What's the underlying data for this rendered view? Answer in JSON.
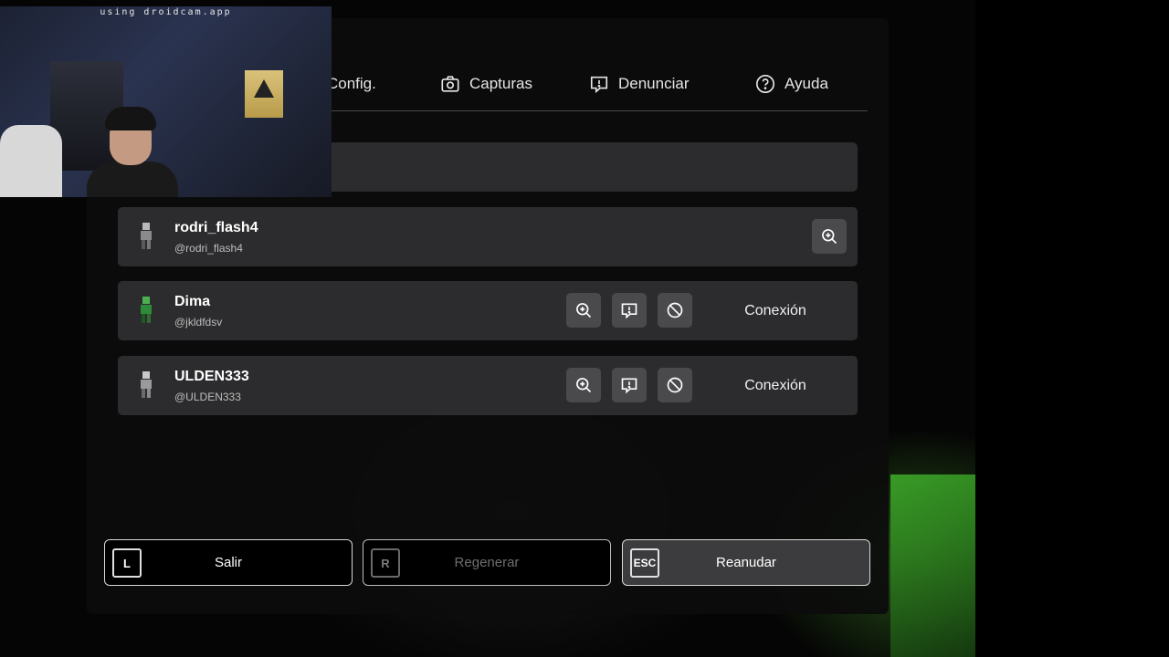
{
  "webcam": {
    "caption": "using droidcam.app"
  },
  "tabs": [
    {
      "label": "Config.",
      "icon": "gear-icon"
    },
    {
      "label": "Capturas",
      "icon": "camera-icon"
    },
    {
      "label": "Denunciar",
      "icon": "report-icon"
    },
    {
      "label": "Ayuda",
      "icon": "help-icon"
    }
  ],
  "players": [
    {
      "name": "rodri_flash4",
      "handle": "@rodri_flash4",
      "connection_label": ""
    },
    {
      "name": "Dima",
      "handle": "@jkldfdsv",
      "connection_label": "Conexión"
    },
    {
      "name": "ULDEN333",
      "handle": "@ULDEN333",
      "connection_label": "Conexión"
    }
  ],
  "bottom_buttons": {
    "leave": {
      "key": "L",
      "label": "Salir"
    },
    "respawn": {
      "key": "R",
      "label": "Regenerar"
    },
    "resume": {
      "key": "ESC",
      "label": "Reanudar"
    }
  },
  "colors": {
    "panel": "#0c0c0c",
    "row": "#2c2c2e",
    "icon_button": "#4a4a4c",
    "accent_green": "#3fb02a"
  }
}
